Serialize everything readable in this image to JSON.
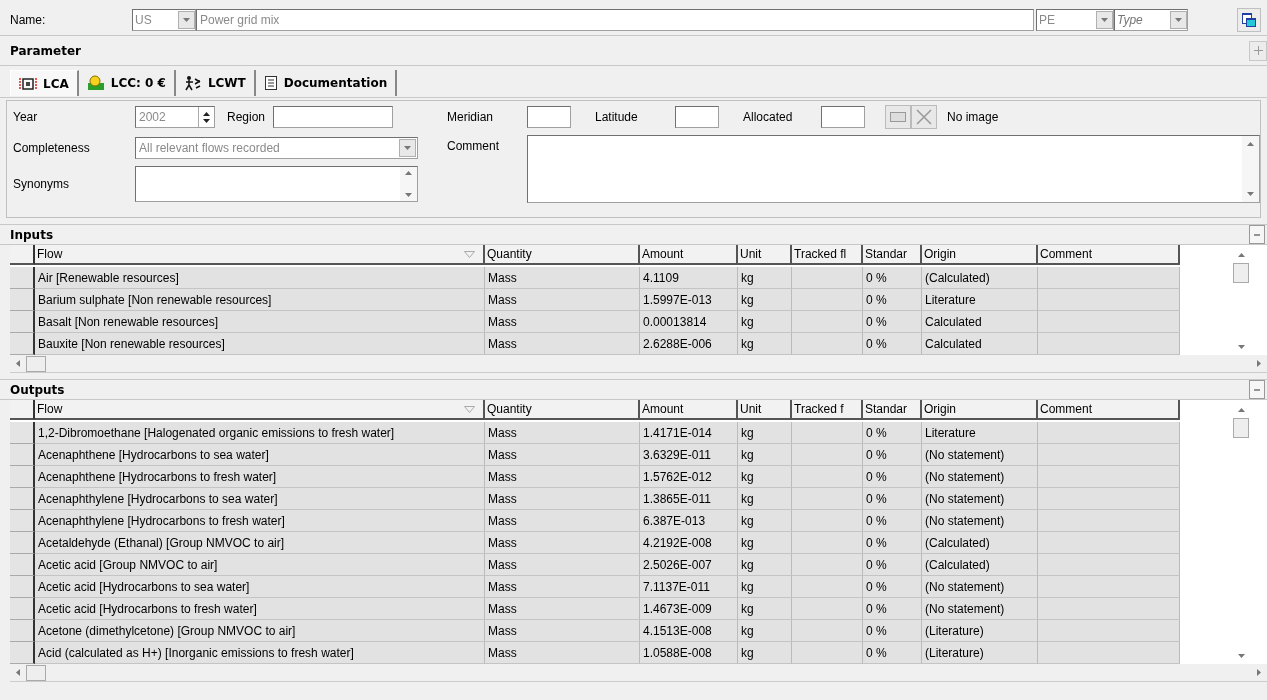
{
  "name_bar": {
    "label": "Name:",
    "country": "US",
    "name": "Power grid mix",
    "source": "PE",
    "type_placeholder": "Type"
  },
  "parameter": {
    "title": "Parameter"
  },
  "tabs": [
    {
      "label": "LCA",
      "kind": "lca",
      "selected": true
    },
    {
      "label": "LCC: 0 €",
      "kind": "lcc",
      "selected": false
    },
    {
      "label": "LCWT",
      "kind": "lcwt",
      "selected": false
    },
    {
      "label": "Documentation",
      "kind": "doc",
      "selected": false
    }
  ],
  "form": {
    "year_label": "Year",
    "year": {
      "value": "2002",
      "disabled": true
    },
    "region_label": "Region",
    "meridian_label": "Meridian",
    "latitude_label": "Latitude",
    "allocated_label": "Allocated",
    "image_text": "No image",
    "completeness_label": "Completeness",
    "completeness": {
      "value": "All relevant flows recorded",
      "disabled": true
    },
    "comment_label": "Comment",
    "synonyms_label": "Synonyms"
  },
  "inputs": {
    "title": "Inputs",
    "columns": [
      "Flow",
      "Quantity",
      "Amount",
      "Unit",
      "Tracked fl",
      "Standar",
      "Origin",
      "Comment"
    ],
    "rows": [
      {
        "flow": "Air [Renewable resources]",
        "quantity": "Mass",
        "amount": "4.1109",
        "unit": "kg",
        "standard": "0 %",
        "origin": "(Calculated)"
      },
      {
        "flow": "Barium sulphate [Non renewable resources]",
        "quantity": "Mass",
        "amount": "1.5997E-013",
        "unit": "kg",
        "standard": "0 %",
        "origin": "Literature"
      },
      {
        "flow": "Basalt [Non renewable resources]",
        "quantity": "Mass",
        "amount": "0.00013814",
        "unit": "kg",
        "standard": "0 %",
        "origin": "Calculated"
      },
      {
        "flow": "Bauxite [Non renewable resources]",
        "quantity": "Mass",
        "amount": "2.6288E-006",
        "unit": "kg",
        "standard": "0 %",
        "origin": "Calculated"
      }
    ]
  },
  "outputs": {
    "title": "Outputs",
    "columns": [
      "Flow",
      "Quantity",
      "Amount",
      "Unit",
      "Tracked f",
      "Standar",
      "Origin",
      "Comment"
    ],
    "rows": [
      {
        "flow": "1,2-Dibromoethane [Halogenated organic emissions to fresh water]",
        "quantity": "Mass",
        "amount": "1.4171E-014",
        "unit": "kg",
        "standard": "0 %",
        "origin": "Literature"
      },
      {
        "flow": "Acenaphthene [Hydrocarbons to sea water]",
        "quantity": "Mass",
        "amount": "3.6329E-011",
        "unit": "kg",
        "standard": "0 %",
        "origin": "(No statement)"
      },
      {
        "flow": "Acenaphthene [Hydrocarbons to fresh water]",
        "quantity": "Mass",
        "amount": "1.5762E-012",
        "unit": "kg",
        "standard": "0 %",
        "origin": "(No statement)"
      },
      {
        "flow": "Acenaphthylene [Hydrocarbons to sea water]",
        "quantity": "Mass",
        "amount": "1.3865E-011",
        "unit": "kg",
        "standard": "0 %",
        "origin": "(No statement)"
      },
      {
        "flow": "Acenaphthylene [Hydrocarbons to fresh water]",
        "quantity": "Mass",
        "amount": "6.387E-013",
        "unit": "kg",
        "standard": "0 %",
        "origin": "(No statement)"
      },
      {
        "flow": "Acetaldehyde (Ethanal) [Group NMVOC to air]",
        "quantity": "Mass",
        "amount": "4.2192E-008",
        "unit": "kg",
        "standard": "0 %",
        "origin": "(Calculated)"
      },
      {
        "flow": "Acetic acid [Group NMVOC to air]",
        "quantity": "Mass",
        "amount": "2.5026E-007",
        "unit": "kg",
        "standard": "0 %",
        "origin": "(Calculated)"
      },
      {
        "flow": "Acetic acid [Hydrocarbons to sea water]",
        "quantity": "Mass",
        "amount": "7.1137E-011",
        "unit": "kg",
        "standard": "0 %",
        "origin": "(No statement)"
      },
      {
        "flow": "Acetic acid [Hydrocarbons to fresh water]",
        "quantity": "Mass",
        "amount": "1.4673E-009",
        "unit": "kg",
        "standard": "0 %",
        "origin": "(No statement)"
      },
      {
        "flow": "Acetone (dimethylcetone) [Group NMVOC to air]",
        "quantity": "Mass",
        "amount": "4.1513E-008",
        "unit": "kg",
        "standard": "0 %",
        "origin": "(Literature)"
      },
      {
        "flow": "Acid (calculated as H+) [Inorganic emissions to fresh water]",
        "quantity": "Mass",
        "amount": "1.0588E-008",
        "unit": "kg",
        "standard": "0 %",
        "origin": "(Literature)"
      }
    ]
  }
}
